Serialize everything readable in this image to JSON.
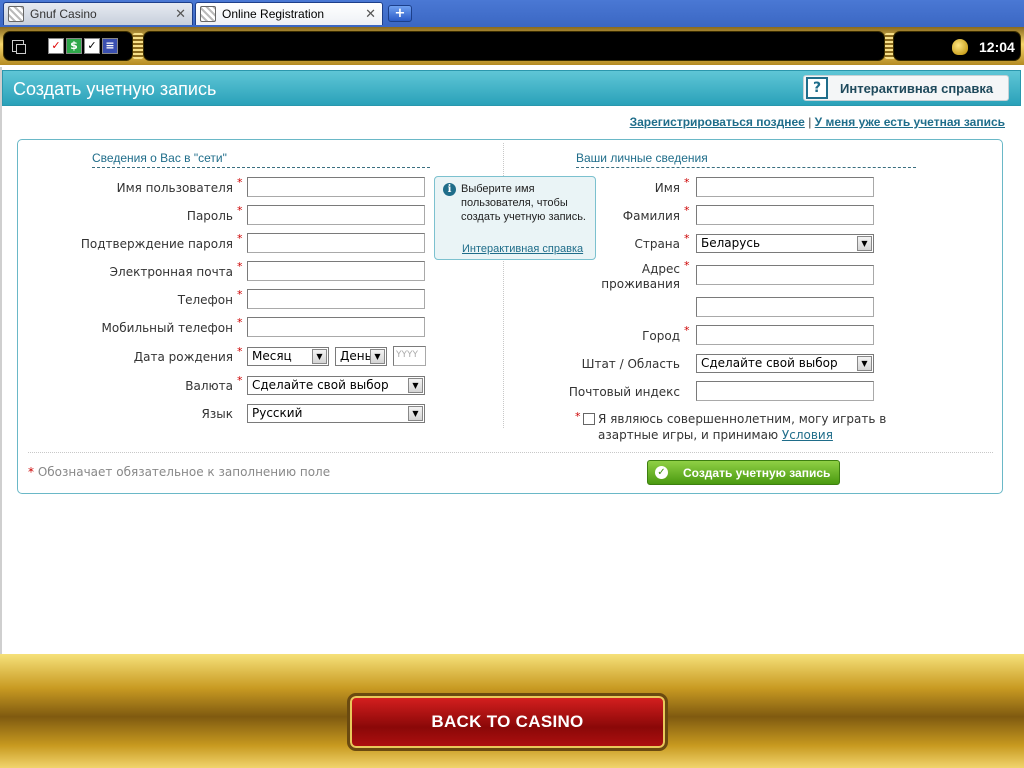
{
  "tabs": [
    {
      "label": "Gnuf Casino"
    },
    {
      "label": "Online Registration"
    }
  ],
  "toolbar": {
    "clock": "12:04"
  },
  "header": {
    "title": "Создать учетную запись",
    "help_button": "Интерактивная справка"
  },
  "top_links": {
    "later": "Зарегистрироваться позднее",
    "separator": "|",
    "have_account": "У меня уже есть учетная запись"
  },
  "online": {
    "section_title": "Сведения о Вас в \"сети\"",
    "username_label": "Имя пользователя",
    "password_label": "Пароль",
    "confirm_password_label": "Подтверждение пароля",
    "email_label": "Электронная почта",
    "phone_label": "Телефон",
    "mobile_label": "Мобильный телефон",
    "birthdate_label": "Дата рождения",
    "month_value": "Месяц",
    "day_value": "День",
    "year_placeholder": "YYYY",
    "currency_label": "Валюта",
    "currency_value": "Сделайте свой выбор",
    "language_label": "Язык",
    "language_value": "Русский"
  },
  "tooltip": {
    "text": "Выберите имя пользователя, чтобы создать учетную запись.",
    "link": "Интерактивная справка"
  },
  "personal": {
    "section_title": "Ваши личные сведения",
    "first_name_label": "Имя",
    "last_name_label": "Фамилия",
    "country_label": "Страна",
    "country_value": "Беларусь",
    "address_label_1": "Адрес",
    "address_label_2": "проживания",
    "city_label": "Город",
    "state_label": "Штат / Область",
    "state_value": "Сделайте свой выбор",
    "postal_label": "Почтовый индекс",
    "agree_text": "Я являюсь совершеннолетним, могу играть в азартные игры, и принимаю",
    "terms_link": "Условия"
  },
  "required_star": "*",
  "required_note": "Обозначает обязательное к заполнению поле",
  "submit_label": "Создать учетную запись",
  "back_label": "BACK TO CASINO"
}
